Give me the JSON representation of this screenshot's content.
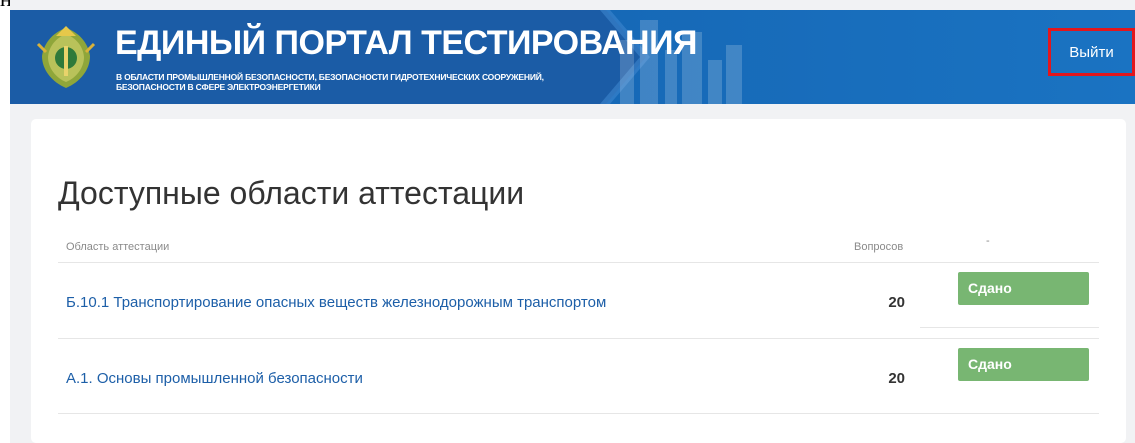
{
  "top_cutoff_text": "нии».",
  "header": {
    "title": "ЕДИНЫЙ ПОРТАЛ ТЕСТИРОВАНИЯ",
    "subtitle": "В ОБЛАСТИ ПРОМЫШЛЕННОЙ БЕЗОПАСНОСТИ, БЕЗОПАСНОСТИ ГИДРОТЕХНИЧЕСКИХ СООРУЖЕНИЙ, БЕЗОПАСНОСТИ В СФЕРЕ ЭЛЕКТРОЭНЕРГЕТИКИ",
    "logout_label": "Выйти",
    "highlight_color": "#e3161c",
    "brand_color": "#1668b6"
  },
  "main": {
    "title": "Доступные области аттестации",
    "table": {
      "columns": [
        "Область аттестации",
        "Вопросов",
        "-"
      ],
      "rows": [
        {
          "name": "Б.10.1 Транспортирование опасных веществ железнодорожным транспортом",
          "questions": "20",
          "status": "Сдано"
        },
        {
          "name": "А.1. Основы промышленной безопасности",
          "questions": "20",
          "status": "Сдано"
        }
      ]
    },
    "status_color": "#78b672",
    "link_color": "#1d5fa8"
  }
}
